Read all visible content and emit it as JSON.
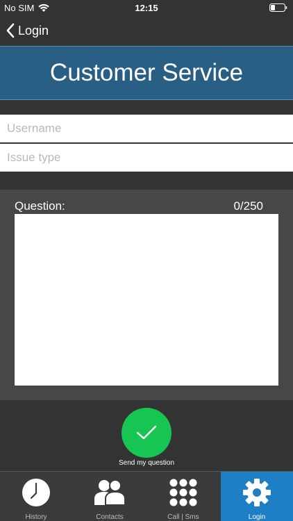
{
  "status_bar": {
    "carrier": "No SIM",
    "time": "12:15"
  },
  "nav": {
    "back_label": "Login"
  },
  "header": {
    "title": "Customer Service"
  },
  "form": {
    "username_placeholder": "Username",
    "username_value": "",
    "issue_placeholder": "Issue type",
    "issue_value": "",
    "question_label": "Question:",
    "question_counter": "0/250",
    "question_value": ""
  },
  "send": {
    "label": "Send my question",
    "color": "#17c552"
  },
  "tabs": [
    {
      "label": "History",
      "icon": "clock-icon",
      "active": false
    },
    {
      "label": "Contacts",
      "icon": "contacts-icon",
      "active": false
    },
    {
      "label": "Call | Sms",
      "icon": "dialpad-icon",
      "active": false
    },
    {
      "label": "Login",
      "icon": "gear-icon",
      "active": true
    }
  ],
  "colors": {
    "header": "#2a5f85",
    "active_tab": "#1e7fc4",
    "background": "#333333"
  }
}
